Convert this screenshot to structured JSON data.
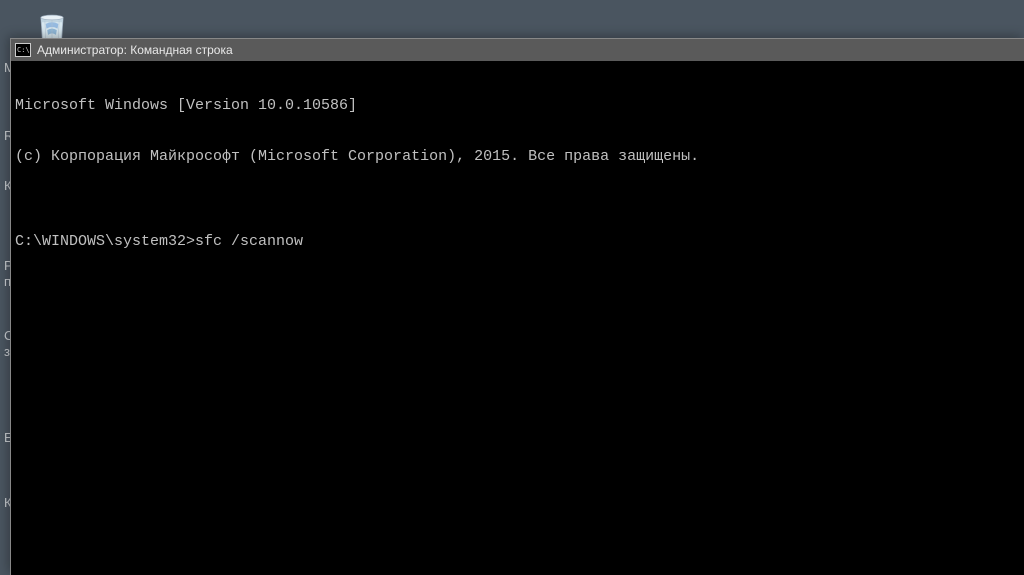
{
  "desktop": {
    "recycle_bin_label": "Корзина"
  },
  "background_text": {
    "l1": "М",
    "l2": "R",
    "l3": "К",
    "l4": "P",
    "l5": "п",
    "l6": "С",
    "l7": "з",
    "l8": "Е",
    "l9": "К"
  },
  "window": {
    "icon_text": "C:\\",
    "title": "Администратор: Командная строка"
  },
  "console": {
    "line1": "Microsoft Windows [Version 10.0.10586]",
    "line2": "(c) Корпорация Майкрософт (Microsoft Corporation), 2015. Все права защищены.",
    "blank": "",
    "prompt": "C:\\WINDOWS\\system32>",
    "command": "sfc /scannow"
  }
}
